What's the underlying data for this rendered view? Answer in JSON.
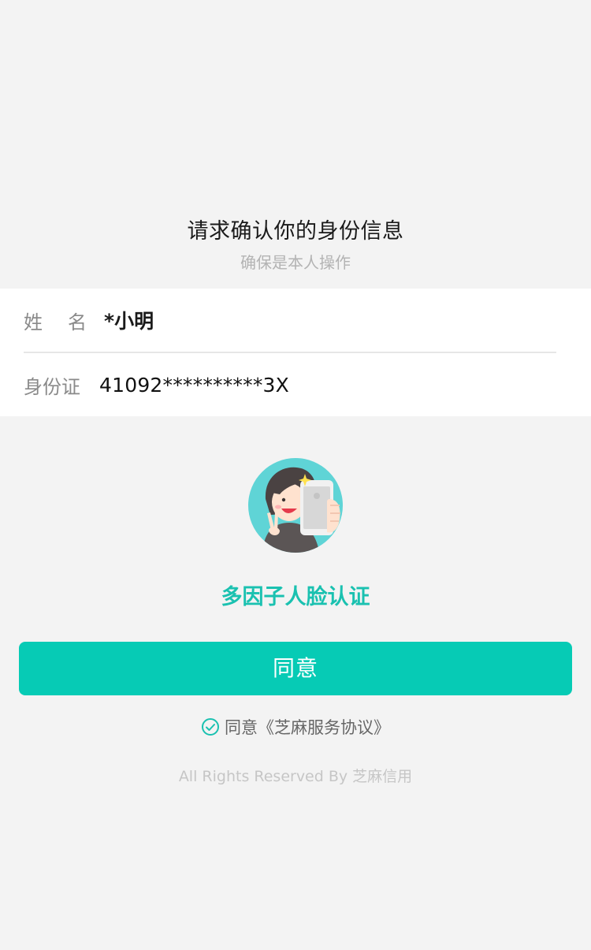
{
  "header": {
    "title": "请求确认你的身份信息",
    "subtitle": "确保是本人操作"
  },
  "form": {
    "name_label_char1": "姓",
    "name_label_char2": "名",
    "name_value": "*小明",
    "id_label": "身份证",
    "id_value": "41092**********3X"
  },
  "feature": {
    "title": "多因子人脸认证",
    "illustration_icon": "face-verify-illustration-icon"
  },
  "actions": {
    "agree_button": "同意",
    "protocol_text": "同意《芝麻服务协议》",
    "protocol_icon": "check-circle-icon"
  },
  "footer": {
    "text": "All Rights Reserved By 芝麻信用"
  },
  "colors": {
    "accent": "#06cbb5",
    "feature_text": "#1ac1b0",
    "background": "#f3f3f3"
  }
}
